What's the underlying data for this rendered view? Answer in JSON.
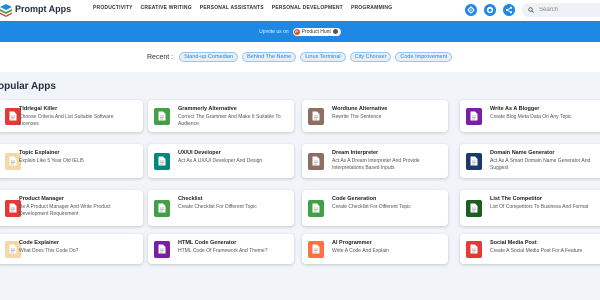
{
  "brand": {
    "name": "Prompt Apps"
  },
  "nav": {
    "links": [
      {
        "label": "PRODUCTIVITY"
      },
      {
        "label": "CREATIVE WRITING"
      },
      {
        "label": "PERSONAL ASSISTANTS"
      },
      {
        "label": "PERSONAL DEVELOPMENT"
      },
      {
        "label": "PROGRAMMING"
      }
    ],
    "icons": [
      "gear-icon",
      "github-icon",
      "share-icon"
    ],
    "search_placeholder": "Search"
  },
  "banner": {
    "text": "Upvote us on",
    "badge_label": "Product Hunt",
    "badge_letter": "P"
  },
  "recent": {
    "label": "Recent :",
    "chips": [
      "Stand-up Comedian",
      "Behind The Name",
      "Linux Terminal",
      "City Chooser",
      "Code Improvement"
    ]
  },
  "section": {
    "title": "opular Apps"
  },
  "cards": [
    {
      "title": "Tldrlegal Killer",
      "desc": "Choose Criteria And List Suitable Software Licenses",
      "color": "#e53935"
    },
    {
      "title": "Grammerly Alternative",
      "desc": "Correct The Grammer And Make It Suitable To Audience",
      "color": "#43a047"
    },
    {
      "title": "Wordtune Alternative",
      "desc": "Rewrite The Sentence",
      "color": "#8d6e63"
    },
    {
      "title": "Write As A Blogger",
      "desc": "Create Blog Meta Data On Any Topic",
      "color": "#7b1fa2"
    },
    {
      "title": "Topic Explainer",
      "desc": "Explain Like 5 Year Old IELI5",
      "color": "#f5d7a8"
    },
    {
      "title": "UX/UI Developer",
      "desc": "Act As A UX/UI Developer And Design",
      "color": "#00897b"
    },
    {
      "title": "Dream Interpreter",
      "desc": "Act As A Dream Interpreter And Provide Interpretations Based Inputs",
      "color": "#8d6e63"
    },
    {
      "title": "Domain Name Generator",
      "desc": "Act As A Smart Domain Name Generator And Suggest",
      "color": "#1a3a6b"
    },
    {
      "title": "Product Manager",
      "desc": "Be A Product Manager And Write Product Development Requirement",
      "color": "#e53935"
    },
    {
      "title": "Checklist",
      "desc": "Create Checklist For Different Topic",
      "color": "#43a047"
    },
    {
      "title": "Code Generation",
      "desc": "Create Checklist For Different Topic",
      "color": "#43a047"
    },
    {
      "title": "List The Competitor",
      "desc": "List Of Competitors To Business And Format",
      "color": "#1b5e20"
    },
    {
      "title": "Code Explainer",
      "desc": "What Does This Code Do?",
      "color": "#f5d7a8"
    },
    {
      "title": "HTML Code Generator",
      "desc": "HTML Code Of Framework And Theme?",
      "color": "#7b1fa2"
    },
    {
      "title": "AI Programmer",
      "desc": "Write A Code And Explain",
      "color": "#ff7043"
    },
    {
      "title": "Social Media Post",
      "desc": "Create A Social Media Post For A Feature",
      "color": "#e53935"
    }
  ]
}
